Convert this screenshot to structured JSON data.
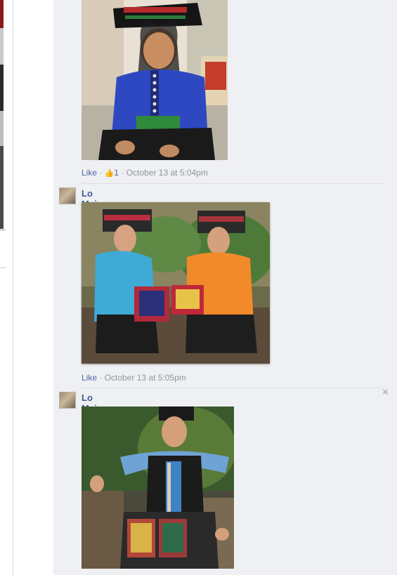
{
  "comments": [
    {
      "author": "",
      "like_label": "Like",
      "likes_count": "1",
      "timestamp": "October 13 at 5:04pm"
    },
    {
      "author": "Lo Mai Cuong",
      "like_label": "Like",
      "timestamp": "October 13 at 5:05pm"
    },
    {
      "author": "Lo Mai Cuong"
    }
  ],
  "separator": "·",
  "icons": {
    "like_count": "thumbs-up-icon",
    "close": "close-icon"
  },
  "close_symbol": "×",
  "colors": {
    "link": "#3b5998",
    "meta": "#90949c",
    "stream_background": "#eff0f3"
  }
}
